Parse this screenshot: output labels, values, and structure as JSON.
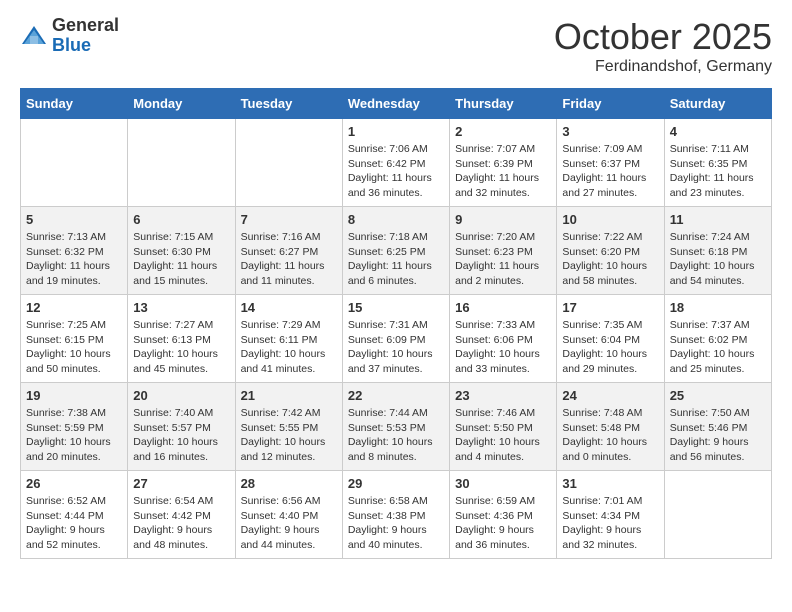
{
  "logo": {
    "general": "General",
    "blue": "Blue"
  },
  "title": "October 2025",
  "subtitle": "Ferdinandshof, Germany",
  "days": [
    "Sunday",
    "Monday",
    "Tuesday",
    "Wednesday",
    "Thursday",
    "Friday",
    "Saturday"
  ],
  "weeks": [
    [
      {
        "day": "",
        "info": ""
      },
      {
        "day": "",
        "info": ""
      },
      {
        "day": "",
        "info": ""
      },
      {
        "day": "1",
        "info": "Sunrise: 7:06 AM\nSunset: 6:42 PM\nDaylight: 11 hours and 36 minutes."
      },
      {
        "day": "2",
        "info": "Sunrise: 7:07 AM\nSunset: 6:39 PM\nDaylight: 11 hours and 32 minutes."
      },
      {
        "day": "3",
        "info": "Sunrise: 7:09 AM\nSunset: 6:37 PM\nDaylight: 11 hours and 27 minutes."
      },
      {
        "day": "4",
        "info": "Sunrise: 7:11 AM\nSunset: 6:35 PM\nDaylight: 11 hours and 23 minutes."
      }
    ],
    [
      {
        "day": "5",
        "info": "Sunrise: 7:13 AM\nSunset: 6:32 PM\nDaylight: 11 hours and 19 minutes."
      },
      {
        "day": "6",
        "info": "Sunrise: 7:15 AM\nSunset: 6:30 PM\nDaylight: 11 hours and 15 minutes."
      },
      {
        "day": "7",
        "info": "Sunrise: 7:16 AM\nSunset: 6:27 PM\nDaylight: 11 hours and 11 minutes."
      },
      {
        "day": "8",
        "info": "Sunrise: 7:18 AM\nSunset: 6:25 PM\nDaylight: 11 hours and 6 minutes."
      },
      {
        "day": "9",
        "info": "Sunrise: 7:20 AM\nSunset: 6:23 PM\nDaylight: 11 hours and 2 minutes."
      },
      {
        "day": "10",
        "info": "Sunrise: 7:22 AM\nSunset: 6:20 PM\nDaylight: 10 hours and 58 minutes."
      },
      {
        "day": "11",
        "info": "Sunrise: 7:24 AM\nSunset: 6:18 PM\nDaylight: 10 hours and 54 minutes."
      }
    ],
    [
      {
        "day": "12",
        "info": "Sunrise: 7:25 AM\nSunset: 6:15 PM\nDaylight: 10 hours and 50 minutes."
      },
      {
        "day": "13",
        "info": "Sunrise: 7:27 AM\nSunset: 6:13 PM\nDaylight: 10 hours and 45 minutes."
      },
      {
        "day": "14",
        "info": "Sunrise: 7:29 AM\nSunset: 6:11 PM\nDaylight: 10 hours and 41 minutes."
      },
      {
        "day": "15",
        "info": "Sunrise: 7:31 AM\nSunset: 6:09 PM\nDaylight: 10 hours and 37 minutes."
      },
      {
        "day": "16",
        "info": "Sunrise: 7:33 AM\nSunset: 6:06 PM\nDaylight: 10 hours and 33 minutes."
      },
      {
        "day": "17",
        "info": "Sunrise: 7:35 AM\nSunset: 6:04 PM\nDaylight: 10 hours and 29 minutes."
      },
      {
        "day": "18",
        "info": "Sunrise: 7:37 AM\nSunset: 6:02 PM\nDaylight: 10 hours and 25 minutes."
      }
    ],
    [
      {
        "day": "19",
        "info": "Sunrise: 7:38 AM\nSunset: 5:59 PM\nDaylight: 10 hours and 20 minutes."
      },
      {
        "day": "20",
        "info": "Sunrise: 7:40 AM\nSunset: 5:57 PM\nDaylight: 10 hours and 16 minutes."
      },
      {
        "day": "21",
        "info": "Sunrise: 7:42 AM\nSunset: 5:55 PM\nDaylight: 10 hours and 12 minutes."
      },
      {
        "day": "22",
        "info": "Sunrise: 7:44 AM\nSunset: 5:53 PM\nDaylight: 10 hours and 8 minutes."
      },
      {
        "day": "23",
        "info": "Sunrise: 7:46 AM\nSunset: 5:50 PM\nDaylight: 10 hours and 4 minutes."
      },
      {
        "day": "24",
        "info": "Sunrise: 7:48 AM\nSunset: 5:48 PM\nDaylight: 10 hours and 0 minutes."
      },
      {
        "day": "25",
        "info": "Sunrise: 7:50 AM\nSunset: 5:46 PM\nDaylight: 9 hours and 56 minutes."
      }
    ],
    [
      {
        "day": "26",
        "info": "Sunrise: 6:52 AM\nSunset: 4:44 PM\nDaylight: 9 hours and 52 minutes."
      },
      {
        "day": "27",
        "info": "Sunrise: 6:54 AM\nSunset: 4:42 PM\nDaylight: 9 hours and 48 minutes."
      },
      {
        "day": "28",
        "info": "Sunrise: 6:56 AM\nSunset: 4:40 PM\nDaylight: 9 hours and 44 minutes."
      },
      {
        "day": "29",
        "info": "Sunrise: 6:58 AM\nSunset: 4:38 PM\nDaylight: 9 hours and 40 minutes."
      },
      {
        "day": "30",
        "info": "Sunrise: 6:59 AM\nSunset: 4:36 PM\nDaylight: 9 hours and 36 minutes."
      },
      {
        "day": "31",
        "info": "Sunrise: 7:01 AM\nSunset: 4:34 PM\nDaylight: 9 hours and 32 minutes."
      },
      {
        "day": "",
        "info": ""
      }
    ]
  ]
}
